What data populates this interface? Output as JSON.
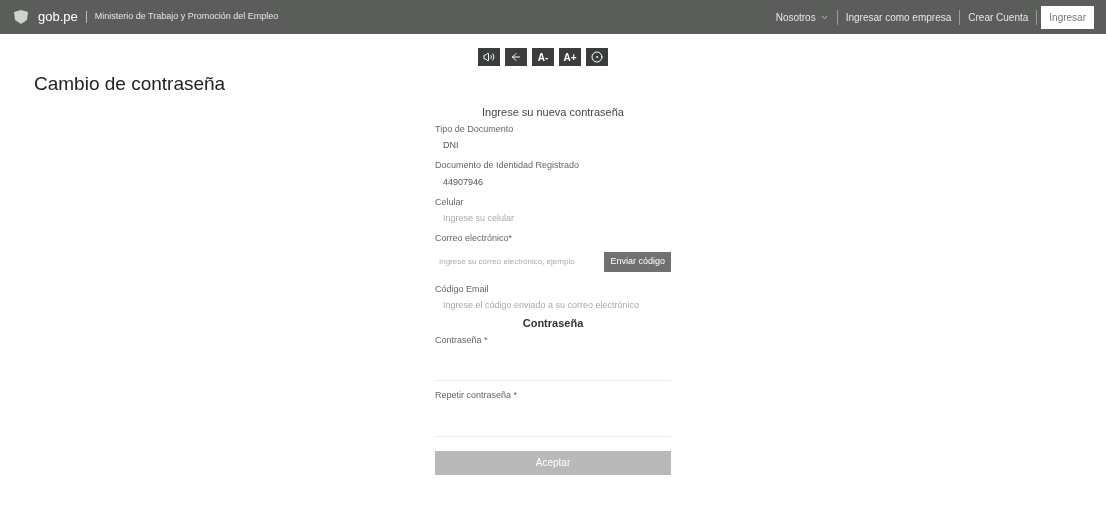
{
  "header": {
    "brand": "gob.pe",
    "ministry": "Ministerio de Trabajo y Promoción del Empleo",
    "nav": [
      {
        "label": "Nosotros",
        "kind": "dropdown"
      },
      {
        "label": "Ingresar como empresa",
        "kind": "link"
      },
      {
        "label": "Crear Cuenta",
        "kind": "link"
      },
      {
        "label": "Ingresar",
        "kind": "button"
      }
    ]
  },
  "accessibility_tools": [
    {
      "kind": "speaker"
    },
    {
      "kind": "back"
    },
    {
      "kind": "text",
      "label": "A-"
    },
    {
      "kind": "text",
      "label": "A+"
    },
    {
      "kind": "contrast"
    }
  ],
  "page_title": "Cambio de contraseña",
  "form": {
    "heading": "Ingrese su nueva contraseña",
    "fields": [
      {
        "kind": "readonly",
        "label": "Tipo de Documento",
        "value": "DNI"
      },
      {
        "kind": "readonly",
        "label": "Documento de Identidad Registrado",
        "value": "44907946"
      },
      {
        "kind": "text",
        "label": "Celular",
        "placeholder": "Ingrese su celular"
      },
      {
        "kind": "action",
        "label": "Correo electrónico*",
        "placeholder": "Ingrese su correo electrónico, ejemplo",
        "button": "Enviar código"
      },
      {
        "kind": "text",
        "label": "Código Email",
        "placeholder": "Ingrese el código enviado a su correo electrónico"
      }
    ],
    "section": "Contraseña",
    "password_fields": [
      {
        "label": "Contraseña *"
      },
      {
        "label": "Repetir contraseña *"
      }
    ],
    "submit": "Aceptar"
  }
}
